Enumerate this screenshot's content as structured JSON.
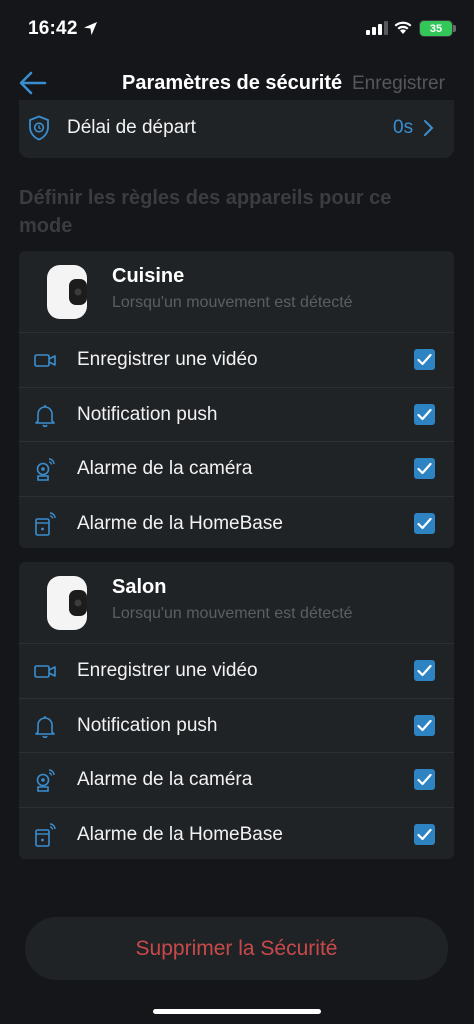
{
  "status": {
    "time": "16:42",
    "battery": "35"
  },
  "nav": {
    "title": "Paramètres de sécurité",
    "action": "Enregistrer"
  },
  "delay": {
    "label": "Délai de départ",
    "value": "0s"
  },
  "section_title": "Définir les règles des appareils pour ce mode",
  "devices": [
    {
      "name": "Cuisine",
      "trigger": "Lorsqu'un mouvement est détecté",
      "rules": [
        {
          "label": "Enregistrer une vidéo",
          "icon": "video-camera-icon",
          "checked": true
        },
        {
          "label": "Notification push",
          "icon": "bell-icon",
          "checked": true
        },
        {
          "label": "Alarme de la caméra",
          "icon": "camera-alarm-icon",
          "checked": true
        },
        {
          "label": "Alarme de la HomeBase",
          "icon": "homebase-alarm-icon",
          "checked": true
        }
      ]
    },
    {
      "name": "Salon",
      "trigger": "Lorsqu'un mouvement est détecté",
      "rules": [
        {
          "label": "Enregistrer une vidéo",
          "icon": "video-camera-icon",
          "checked": true
        },
        {
          "label": "Notification push",
          "icon": "bell-icon",
          "checked": true
        },
        {
          "label": "Alarme de la caméra",
          "icon": "camera-alarm-icon",
          "checked": true
        },
        {
          "label": "Alarme de la HomeBase",
          "icon": "homebase-alarm-icon",
          "checked": true
        }
      ]
    }
  ],
  "delete_button": "Supprimer la Sécurité",
  "colors": {
    "accent": "#2e83c3",
    "danger": "#c9494a",
    "card": "#202326",
    "background": "#151619"
  }
}
